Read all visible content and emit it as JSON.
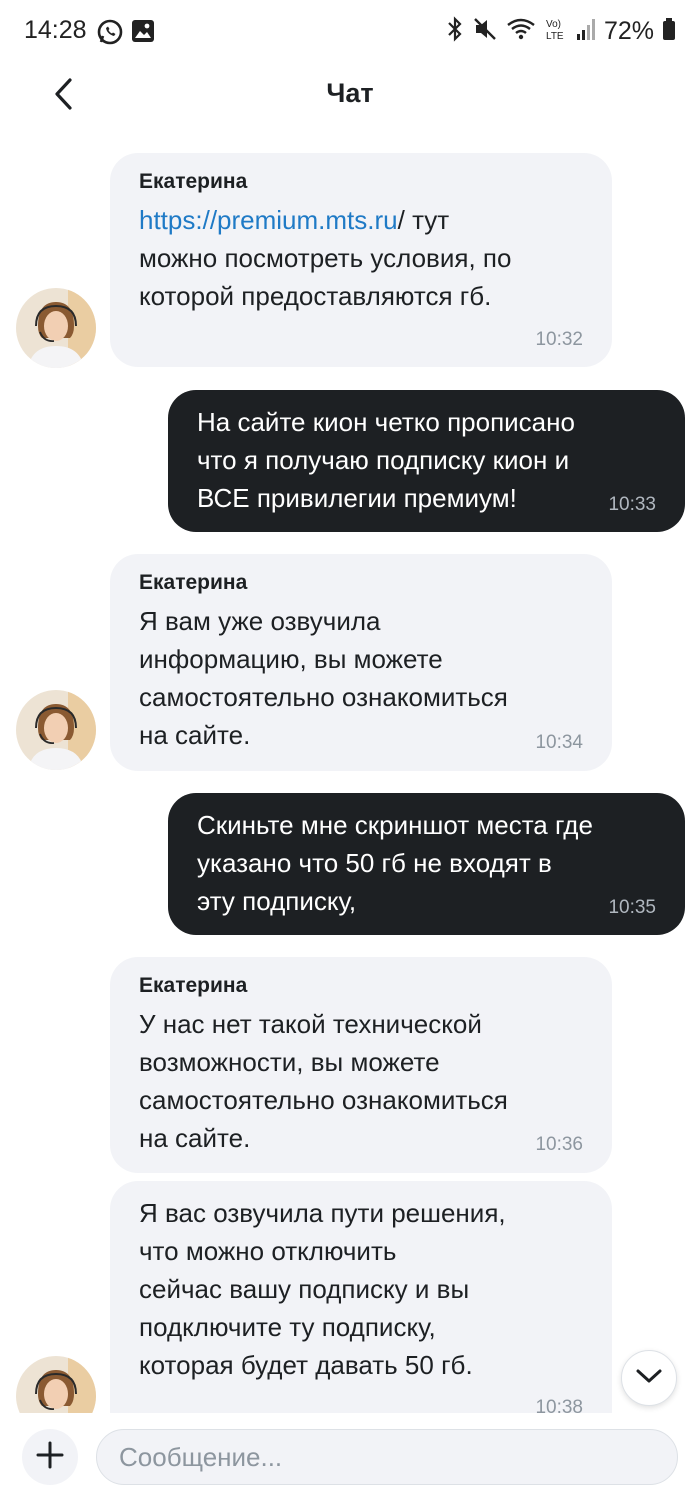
{
  "status_bar": {
    "time": "14:28",
    "battery": "72%",
    "icons": [
      "whatsapp-icon",
      "gallery-icon",
      "bluetooth-icon",
      "mute-icon",
      "wifi-icon",
      "volte-icon",
      "signal-icon",
      "battery-icon"
    ]
  },
  "header": {
    "title": "Чат",
    "back_icon": "chevron-left-icon"
  },
  "messages": [
    {
      "direction": "incoming",
      "sender": "Екатерина",
      "link": "https://premium.mts.ru",
      "text_after_link": "/ тут",
      "text_rest": "можно посмотреть условия, по\nкоторой предоставляются гб.",
      "time": "10:32"
    },
    {
      "direction": "outgoing",
      "text": "На сайте кион четко прописано\nчто я получаю подписку кион и\nВСЕ привилегии премиум!",
      "time": "10:33"
    },
    {
      "direction": "incoming",
      "sender": "Екатерина",
      "text": "Я вам уже озвучила\nинформацию, вы можете\nсамостоятельно ознакомиться\nна сайте.",
      "time": "10:34"
    },
    {
      "direction": "outgoing",
      "text": "Скиньте мне скриншот места где\nуказано что 50 гб не входят в\nэту подписку,",
      "time": "10:35"
    },
    {
      "direction": "incoming",
      "sender": "Екатерина",
      "text": "У нас нет такой технической\nвозможности, вы можете\nсамостоятельно ознакомиться\nна сайте.",
      "time": "10:36"
    },
    {
      "direction": "incoming",
      "text": "Я вас озвучила пути решения,\nчто можно отключить\nсейчас вашу подписку и вы\nподключите ту подписку,\nкоторая будет давать 50 гб.",
      "time": "10:38"
    }
  ],
  "scroll_down_icon": "chevron-down-icon",
  "composer": {
    "attach_icon": "plus-icon",
    "placeholder": "Сообщение..."
  },
  "colors": {
    "incoming_bubble": "#f2f3f7",
    "outgoing_bubble": "#1d2023",
    "link": "#1f7ac6",
    "timestamp": "#8d969f"
  }
}
